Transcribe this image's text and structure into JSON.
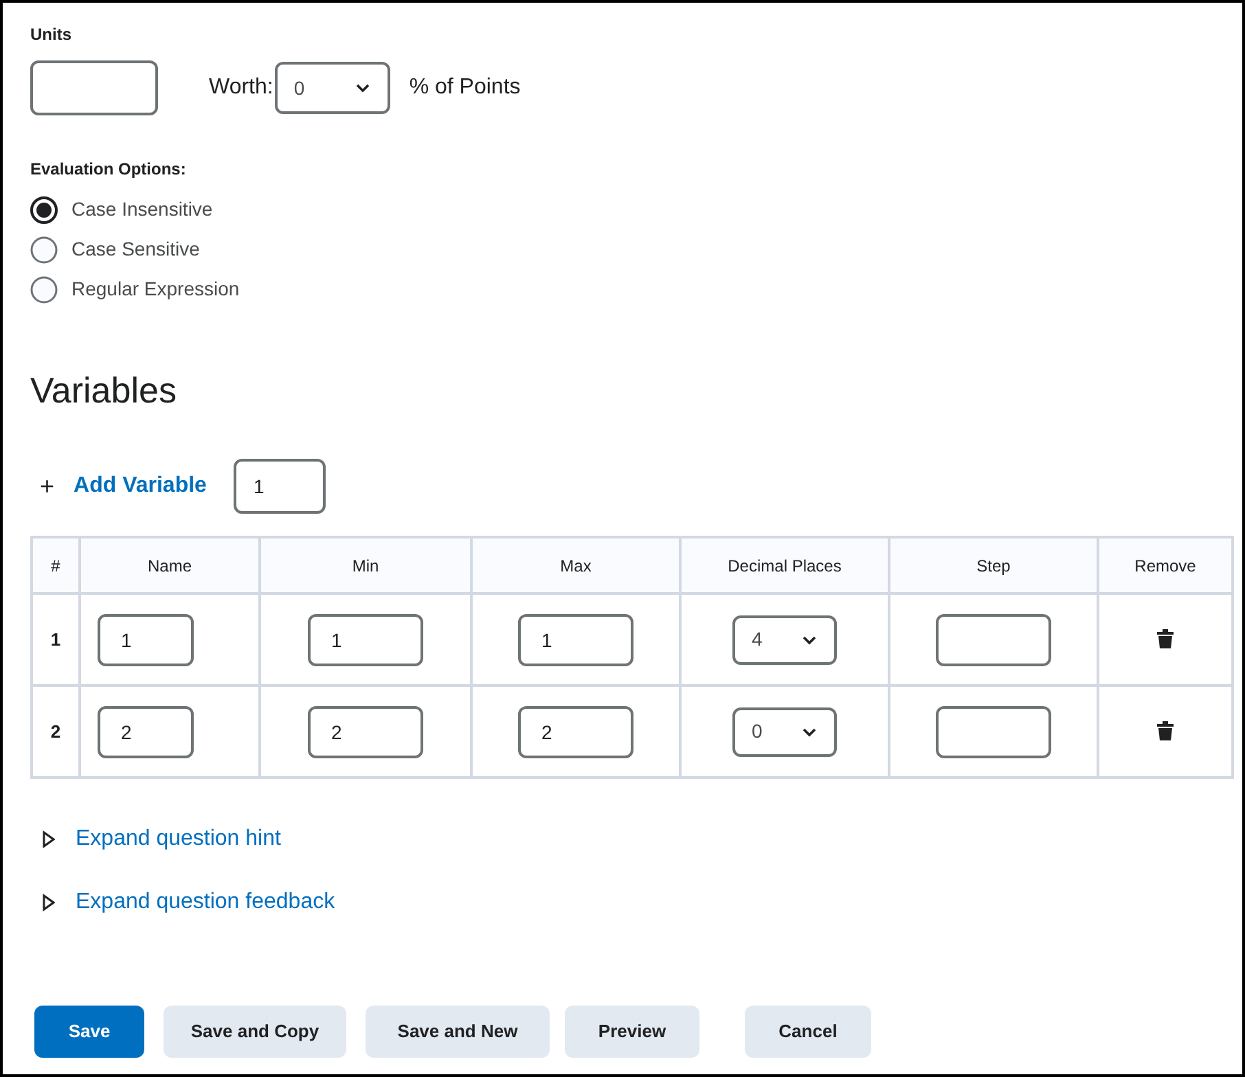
{
  "units": {
    "label": "Units"
  },
  "worth": {
    "label": "Worth:",
    "value": "0",
    "suffix": "% of Points"
  },
  "evaluation": {
    "label": "Evaluation Options:",
    "options": [
      {
        "label": "Case Insensitive",
        "selected": true
      },
      {
        "label": "Case Sensitive",
        "selected": false
      },
      {
        "label": "Regular Expression",
        "selected": false
      }
    ]
  },
  "variables": {
    "heading": "Variables",
    "add_icon": "+",
    "add_label": "Add Variable",
    "add_count": "1",
    "columns": [
      "#",
      "Name",
      "Min",
      "Max",
      "Decimal Places",
      "Step",
      "Remove"
    ],
    "rows": [
      {
        "index": "1",
        "name": "1",
        "min": "1",
        "max": "1",
        "decimal_places": "4"
      },
      {
        "index": "2",
        "name": "2",
        "min": "2",
        "max": "2",
        "decimal_places": "0"
      }
    ]
  },
  "expanders": [
    {
      "label": "Expand question hint",
      "expanded": false
    },
    {
      "label": "Expand question feedback",
      "expanded": false
    }
  ],
  "buttons": [
    {
      "label": "Save",
      "kind": "primary"
    },
    {
      "label": "Save and Copy",
      "kind": "secondary"
    },
    {
      "label": "Save and New",
      "kind": "secondary"
    },
    {
      "label": "Preview",
      "kind": "secondary"
    },
    {
      "label": "Cancel",
      "kind": "secondary"
    }
  ]
}
